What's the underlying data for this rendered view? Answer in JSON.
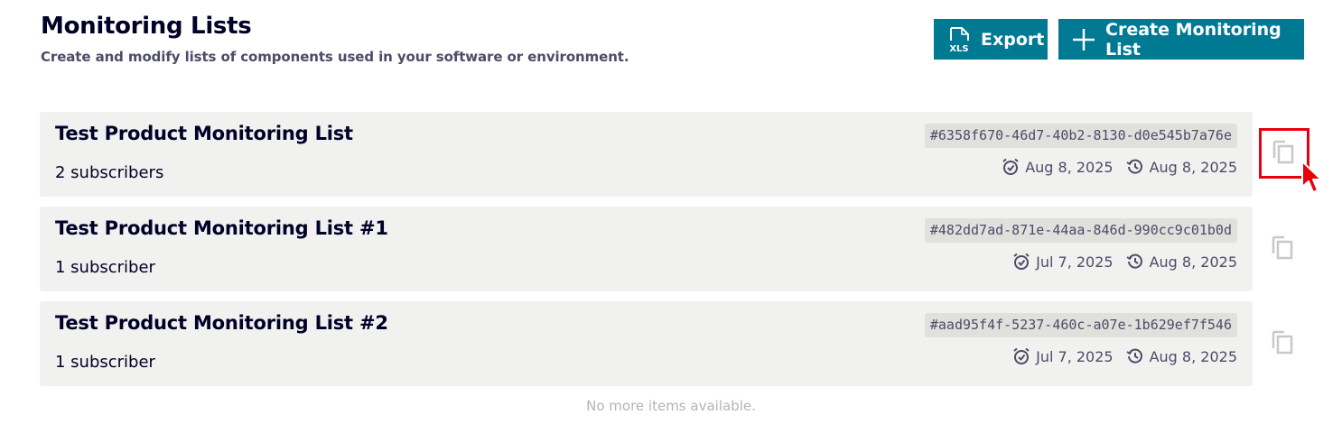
{
  "header": {
    "title": "Monitoring Lists",
    "subtitle": "Create and modify lists of components used in your software or environment."
  },
  "actions": {
    "export_label": "Export",
    "export_icon": "xls-file-icon",
    "export_icon_text": "XLS",
    "create_label": "Create Monitoring List",
    "create_icon": "plus-icon"
  },
  "lists": [
    {
      "name": "Test Product Monitoring List",
      "subscribers": "2 subscribers",
      "id": "#6358f670-46d7-40b2-8130-d0e545b7a76e",
      "created": "Aug 8, 2025",
      "updated": "Aug 8, 2025"
    },
    {
      "name": "Test Product Monitoring List #1",
      "subscribers": "1 subscriber",
      "id": "#482dd7ad-871e-44aa-846d-990cc9c01b0d",
      "created": "Jul 7, 2025",
      "updated": "Aug 8, 2025"
    },
    {
      "name": "Test Product Monitoring List #2",
      "subscribers": "1 subscriber",
      "id": "#aad95f4f-5237-460c-a07e-1b629ef7f546",
      "created": "Jul 7, 2025",
      "updated": "Aug 8, 2025"
    }
  ],
  "footer": {
    "message": "No more items available."
  },
  "colors": {
    "accent": "#007993",
    "row_background": "#f1f1ef",
    "highlight": "#e8000d"
  }
}
